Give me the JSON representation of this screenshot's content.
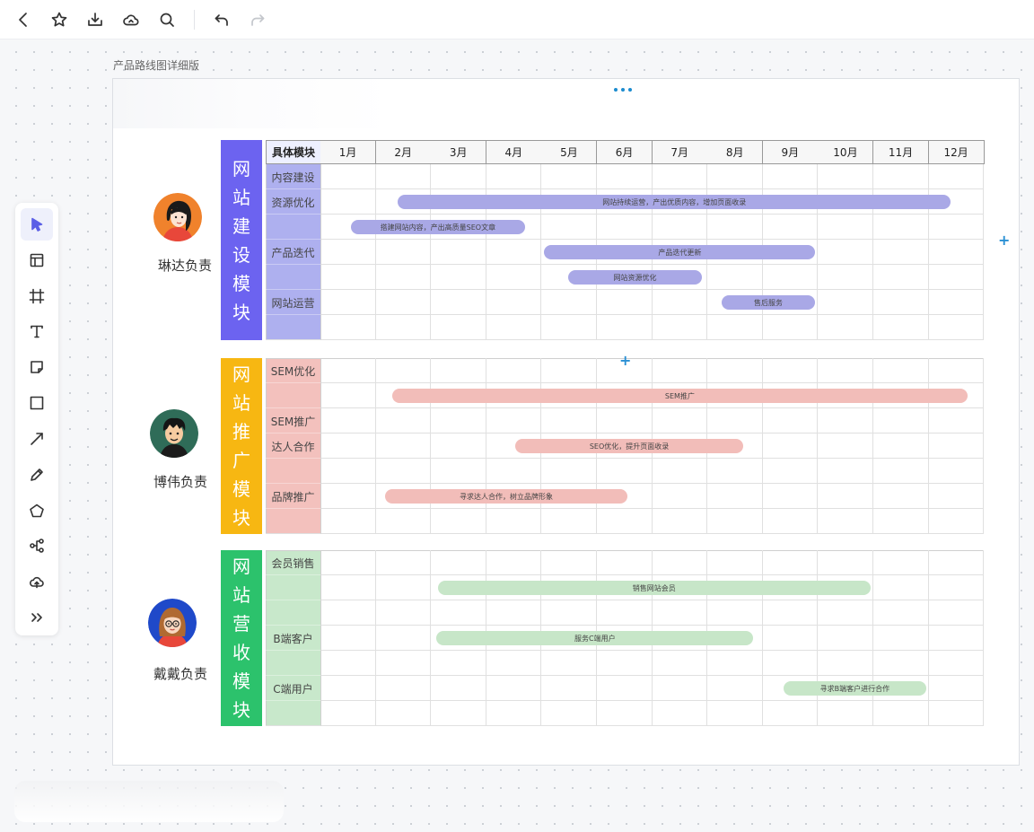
{
  "toolbar": {
    "buttons": [
      {
        "name": "back-button",
        "icon": "chevron-left-icon"
      },
      {
        "name": "favorite-button",
        "icon": "star-icon"
      },
      {
        "name": "download-button",
        "icon": "download-icon"
      },
      {
        "name": "cloud-sync-button",
        "icon": "cloud-icon"
      },
      {
        "name": "search-button",
        "icon": "search-icon"
      },
      {
        "name": "undo-button",
        "icon": "undo-icon"
      },
      {
        "name": "redo-button",
        "icon": "redo-icon",
        "disabled": true
      }
    ]
  },
  "palette": {
    "tools": [
      "select-tool",
      "template-tool",
      "frame-tool",
      "text-tool",
      "sticky-note-tool",
      "shape-tool",
      "arrow-tool",
      "pen-tool",
      "polygon-tool",
      "mindmap-tool",
      "upload-tool",
      "more-tools"
    ]
  },
  "frame": {
    "title": "产品路线图详细版"
  },
  "roadmap": {
    "header_first": "具体模块",
    "months": [
      "1月",
      "2月",
      "3月",
      "4月",
      "5月",
      "6月",
      "7月",
      "8月",
      "9月",
      "10月",
      "11月",
      "12月"
    ],
    "sections": [
      {
        "key": "website-build",
        "title": "网站建设模块",
        "owner": "琳达负责",
        "band_color": "#6c63f0",
        "label_bg": "#aeb0ef",
        "bar_color": "#a9a8e6",
        "labels": [
          {
            "row": 0,
            "text": "内容建设"
          },
          {
            "row": 1,
            "text": "资源优化"
          },
          {
            "row": 3,
            "text": "产品迭代"
          },
          {
            "row": 5,
            "text": "网站运营"
          }
        ],
        "bars": [
          {
            "row": 1,
            "start": 2.4,
            "end": 12.4,
            "text": "网站持续运营，产出优质内容，增加页面收录"
          },
          {
            "row": 2,
            "start": 1.55,
            "end": 4.7,
            "text": "搭建网站内容，产出高质量SEO文章"
          },
          {
            "row": 3,
            "start": 5.05,
            "end": 9.95,
            "text": "产品迭代更新"
          },
          {
            "row": 4,
            "start": 5.48,
            "end": 7.9,
            "text": "网站资源优化"
          },
          {
            "row": 5,
            "start": 8.25,
            "end": 9.95,
            "text": "售后服务"
          }
        ]
      },
      {
        "key": "website-promo",
        "title": "网站推广模块",
        "owner": "博伟负责",
        "band_color": "#f7b712",
        "label_bg": "#f3c1bd",
        "bar_color": "#f2bdb9",
        "labels": [
          {
            "row": 0,
            "text": "SEM优化"
          },
          {
            "row": 2,
            "text": "SEM推广"
          },
          {
            "row": 3,
            "text": "达人合作"
          },
          {
            "row": 5,
            "text": "品牌推广"
          }
        ],
        "bars": [
          {
            "row": 1,
            "start": 2.3,
            "end": 12.7,
            "text": "SEM推广"
          },
          {
            "row": 3,
            "start": 4.52,
            "end": 8.65,
            "text": "SEO优化，提升页面收录"
          },
          {
            "row": 5,
            "start": 2.17,
            "end": 6.55,
            "text": "寻求达人合作，树立品牌形象"
          }
        ]
      },
      {
        "key": "website-revenue",
        "title": "网站营收模块",
        "owner": "戴戴负责",
        "band_color": "#2cc26c",
        "label_bg": "#c8e8cb",
        "bar_color": "#c7e6c8",
        "labels": [
          {
            "row": 0,
            "text": "会员销售"
          },
          {
            "row": 3,
            "text": "B端客户"
          },
          {
            "row": 5,
            "text": "C端用户"
          }
        ],
        "bars": [
          {
            "row": 1,
            "start": 3.12,
            "end": 10.95,
            "text": "销售网站会员"
          },
          {
            "row": 3,
            "start": 3.1,
            "end": 8.83,
            "text": "服务C端用户"
          },
          {
            "row": 5,
            "start": 9.38,
            "end": 11.95,
            "text": "寻求B端客户进行合作"
          }
        ]
      }
    ]
  }
}
